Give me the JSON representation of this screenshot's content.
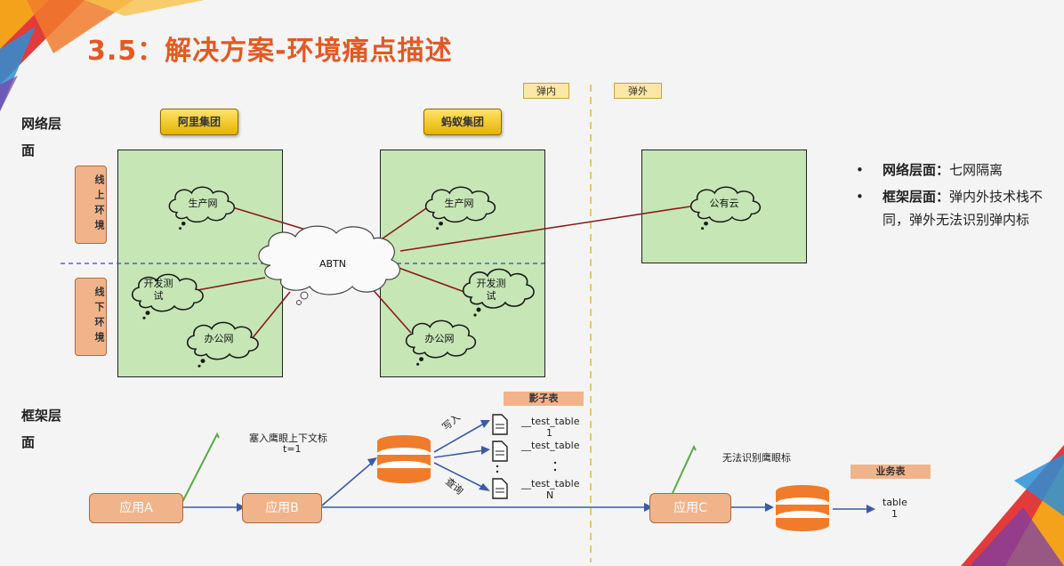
{
  "title": "3.5：解决方案-环境痛点描述",
  "labels": {
    "network_layer": "网络层面",
    "framework_layer": "框架层面"
  },
  "tags": {
    "inside": "弹内",
    "outside": "弹外"
  },
  "groups": {
    "ali": "阿里集团",
    "ant": "蚂蚁集团"
  },
  "env": {
    "online": "线上环境",
    "offline": "线下环境"
  },
  "clouds": {
    "ali_prod": "生产网",
    "ali_dev": "开发测试",
    "ali_office": "办公网",
    "abtn": "ABTN",
    "ant_prod": "生产网",
    "ant_dev": "开发测试",
    "ant_office": "办公网",
    "public": "公有云"
  },
  "bullets": [
    {
      "head": "网络层面：",
      "text": "七网隔离"
    },
    {
      "head": "框架层面：",
      "text": "弹内外技术栈不同，弹外无法识别弹内标"
    }
  ],
  "framework": {
    "shadow_table": "影子表",
    "business_table": "业务表",
    "apps": [
      "应用A",
      "应用B",
      "应用C"
    ],
    "ctx_note_1": "塞入鹰眼上下文标",
    "ctx_note_2": "t=1",
    "write": "写入",
    "query": "查询",
    "table_1": "__test_table",
    "table_1_idx": "1",
    "table_2": "__test_table",
    "table_n": "__test_table",
    "table_n_idx": "N",
    "cannot_identify": "无法识别鹰眼标",
    "biz_table_name": "table",
    "biz_table_idx": "1"
  },
  "colors": {
    "accent": "#e15a24",
    "green": "#c6e6b6",
    "app": "#f1b38a",
    "link": "#8b1a1a",
    "arrow": "#3b5ba5"
  }
}
